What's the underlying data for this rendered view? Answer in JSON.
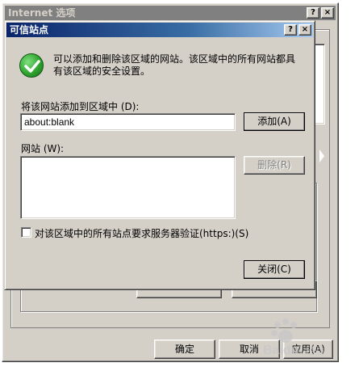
{
  "background_window": {
    "title": "Internet 选项",
    "help_btn": "?",
    "close_btn": "×",
    "buttons": {
      "ok": "确定",
      "cancel": "取消",
      "apply": "应用(A)"
    }
  },
  "dialog": {
    "title": "可信站点",
    "help_btn": "?",
    "close_btn": "×",
    "info_text": "可以添加和删除该区域的网站。该区域中的所有网站都具有该区域的安全设置。",
    "add_label": "将该网站添加到区域中 (D):",
    "url_value": "about:blank",
    "add_button": "添加(A)",
    "sites_label": "网站 (W):",
    "sites": [],
    "remove_button": "删除(R)",
    "https_checkbox": {
      "label": "对该区域中的所有站点要求服务器验证(https:)(S)",
      "checked": false
    },
    "close_button": "关闭(C)"
  },
  "icons": {
    "info": "green-check-icon"
  },
  "colors": {
    "title_active": "#0a246a",
    "title_inactive": "#808080",
    "face": "#d4d0c8"
  }
}
